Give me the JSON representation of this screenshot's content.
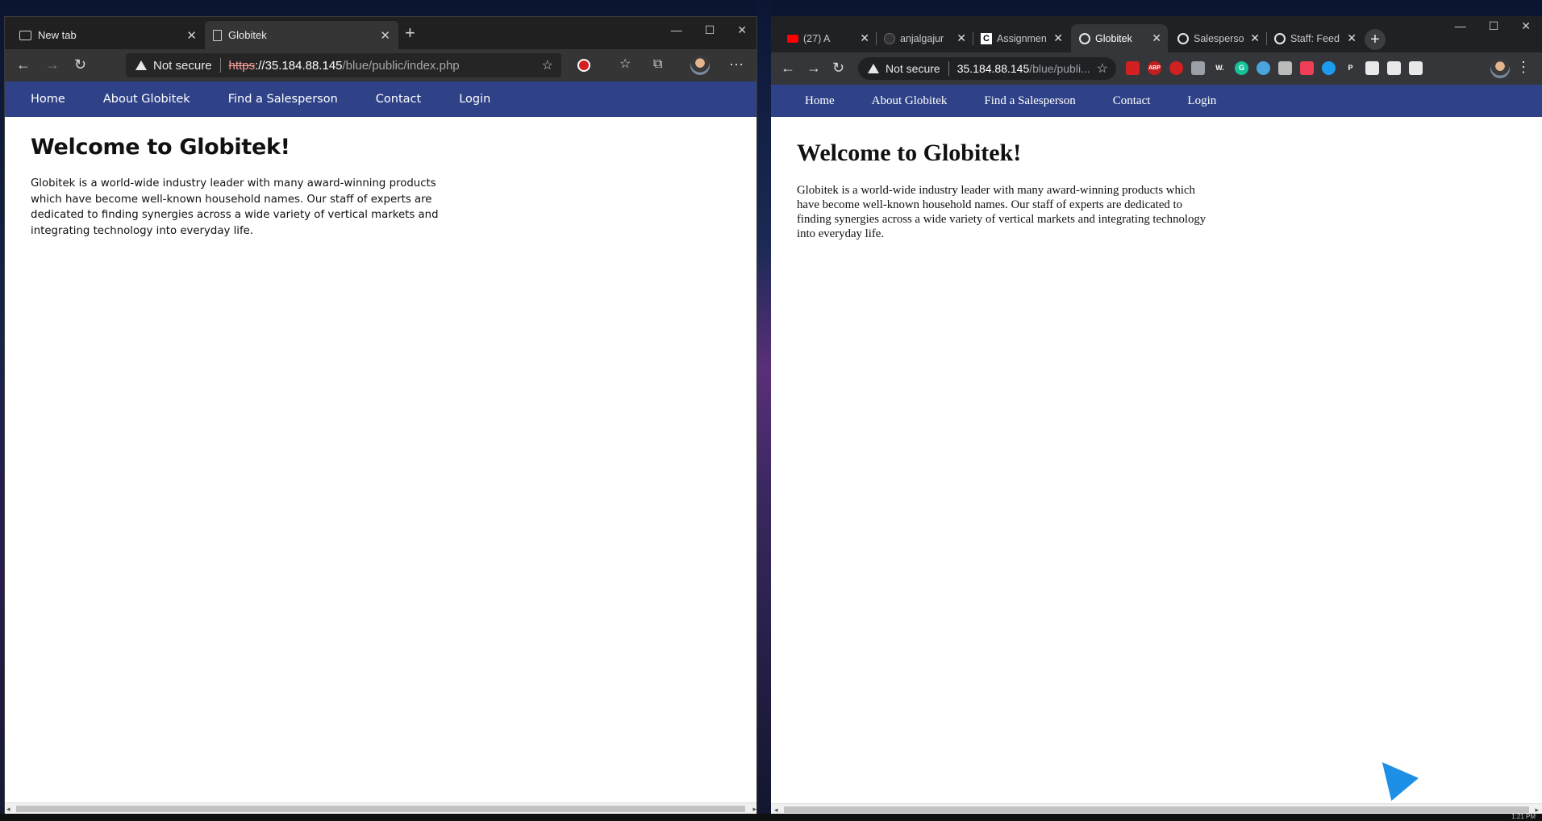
{
  "left_window": {
    "tabs": [
      {
        "label": "New tab",
        "icon": "new-tab-icon",
        "active": false
      },
      {
        "label": "Globitek",
        "icon": "page-icon",
        "active": true
      }
    ],
    "address": {
      "security_label": "Not secure",
      "scheme": "https",
      "host": "://35.184.88.145",
      "path": "/blue/public/index.php"
    },
    "nav": [
      "Home",
      "About Globitek",
      "Find a Salesperson",
      "Contact",
      "Login"
    ],
    "heading": "Welcome to Globitek!",
    "paragraph": "Globitek is a world-wide industry leader with many award-winning products which have become well-known household names. Our staff of experts are dedicated to finding synergies across a wide variety of vertical markets and integrating technology into everyday life."
  },
  "right_window": {
    "tabs": [
      {
        "label": "(27) A",
        "icon": "youtube-icon",
        "active": false
      },
      {
        "label": "anjalgajur",
        "icon": "github-icon",
        "active": false
      },
      {
        "label": "Assignmen",
        "icon": "c-icon",
        "active": false
      },
      {
        "label": "Globitek",
        "icon": "globe-icon",
        "active": true
      },
      {
        "label": "Salesperso",
        "icon": "globe-icon",
        "active": false
      },
      {
        "label": "Staff: Feed",
        "icon": "globe-icon",
        "active": false
      }
    ],
    "address": {
      "security_label": "Not secure",
      "host": "35.184.88.145",
      "path": "/blue/publi..."
    },
    "extensions": [
      "lock-ext",
      "abp-ext",
      "stop-ext",
      "ext-4",
      "w-ext",
      "grammarly-ext",
      "ext-7",
      "camera-ext",
      "pocket-ext",
      "bird-ext",
      "p-ext",
      "shield-ext",
      "puzzle-ext",
      "queue-ext"
    ],
    "ext_labels": [
      "",
      "ABP",
      "",
      "",
      "W.",
      "G",
      "",
      "",
      "",
      "",
      "P",
      "",
      "",
      ""
    ],
    "nav": [
      "Home",
      "About Globitek",
      "Find a Salesperson",
      "Contact",
      "Login"
    ],
    "heading": "Welcome to Globitek!",
    "paragraph": "Globitek is a world-wide industry leader with many award-winning products which have become well-known household names. Our staff of experts are dedicated to finding synergies across a wide variety of vertical markets and integrating technology into everyday life."
  },
  "taskbar": {
    "clock": "1:21 PM"
  },
  "colors": {
    "nav_bg": "#2f4288",
    "edge_chrome": "#202020",
    "chrome_chrome": "#202124"
  }
}
